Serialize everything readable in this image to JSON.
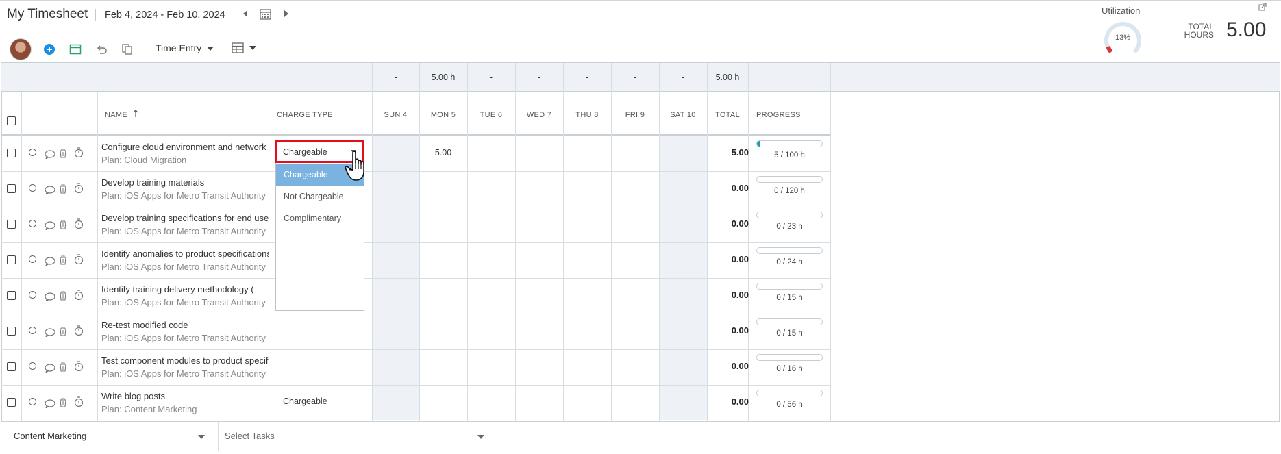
{
  "header": {
    "title": "My Timesheet",
    "date_range": "Feb 4, 2024 - Feb 10, 2024",
    "utilization_label": "Utilization",
    "utilization_value": "13%",
    "total_hours_label_1": "TOTAL",
    "total_hours_label_2": "HOURS",
    "total_hours_value": "5.00"
  },
  "toolbar": {
    "icons": [
      "avatar",
      "add-icon",
      "calendar-icon",
      "undo-icon",
      "copy-icon"
    ],
    "view_label": "Time Entry",
    "layout_icon": "grid-layout-icon"
  },
  "summary_row": {
    "days": [
      "-",
      "5.00 h",
      "-",
      "-",
      "-",
      "-",
      "-"
    ],
    "total": "5.00 h"
  },
  "columns": {
    "name": "NAME",
    "charge_type": "CHARGE TYPE",
    "days": [
      "SUN 4",
      "MON 5",
      "TUE 6",
      "WED 7",
      "THU 8",
      "FRI 9",
      "SAT 10"
    ],
    "total": "TOTAL",
    "progress": "PROGRESS"
  },
  "rows": [
    {
      "name": "Configure cloud environment and network",
      "plan": "Plan: Cloud Migration",
      "charge": "Chargeable",
      "mon": "5.00",
      "total": "5.00",
      "progress_text": "5 / 100 h",
      "progress": 0.05
    },
    {
      "name": "Develop training materials",
      "plan": "Plan: iOS Apps for Metro Transit Authority",
      "charge": "",
      "mon": "",
      "total": "0.00",
      "progress_text": "0 / 120 h",
      "progress": 0
    },
    {
      "name": "Develop training specifications for end users",
      "plan": "Plan: iOS Apps for Metro Transit Authority",
      "charge": "",
      "mon": "",
      "total": "0.00",
      "progress_text": "0 / 23 h",
      "progress": 0
    },
    {
      "name": "Identify anomalies to product specifications",
      "plan": "Plan: iOS Apps for Metro Transit Authority",
      "charge": "",
      "mon": "",
      "total": "0.00",
      "progress_text": "0 / 24 h",
      "progress": 0
    },
    {
      "name": "Identify training delivery methodology (",
      "plan": "Plan: iOS Apps for Metro Transit Authority",
      "charge": "",
      "mon": "",
      "total": "0.00",
      "progress_text": "0 / 15 h",
      "progress": 0
    },
    {
      "name": "Re-test modified code",
      "plan": "Plan: iOS Apps for Metro Transit Authority",
      "charge": "",
      "mon": "",
      "total": "0.00",
      "progress_text": "0 / 15 h",
      "progress": 0
    },
    {
      "name": "Test component modules to product specifications",
      "plan": "Plan: iOS Apps for Metro Transit Authority",
      "charge": "",
      "mon": "",
      "total": "0.00",
      "progress_text": "0 / 16 h",
      "progress": 0
    },
    {
      "name": "Write blog posts",
      "plan": "Plan: Content Marketing",
      "charge": "Chargeable",
      "mon": "",
      "total": "0.00",
      "progress_text": "0 / 56 h",
      "progress": 0
    }
  ],
  "charge_dropdown": {
    "current": "Chargeable",
    "options": [
      "Chargeable",
      "Not Chargeable",
      "Complimentary"
    ],
    "selected_index": 0
  },
  "bottom_bar": {
    "project_select": "Content Marketing",
    "task_select_placeholder": "Select Tasks"
  },
  "colors": {
    "accent": "#1a9ac0",
    "highlight_border": "#e00f1b",
    "dropdown_selected": "#7ab3e0",
    "band": "#eef2f6"
  }
}
